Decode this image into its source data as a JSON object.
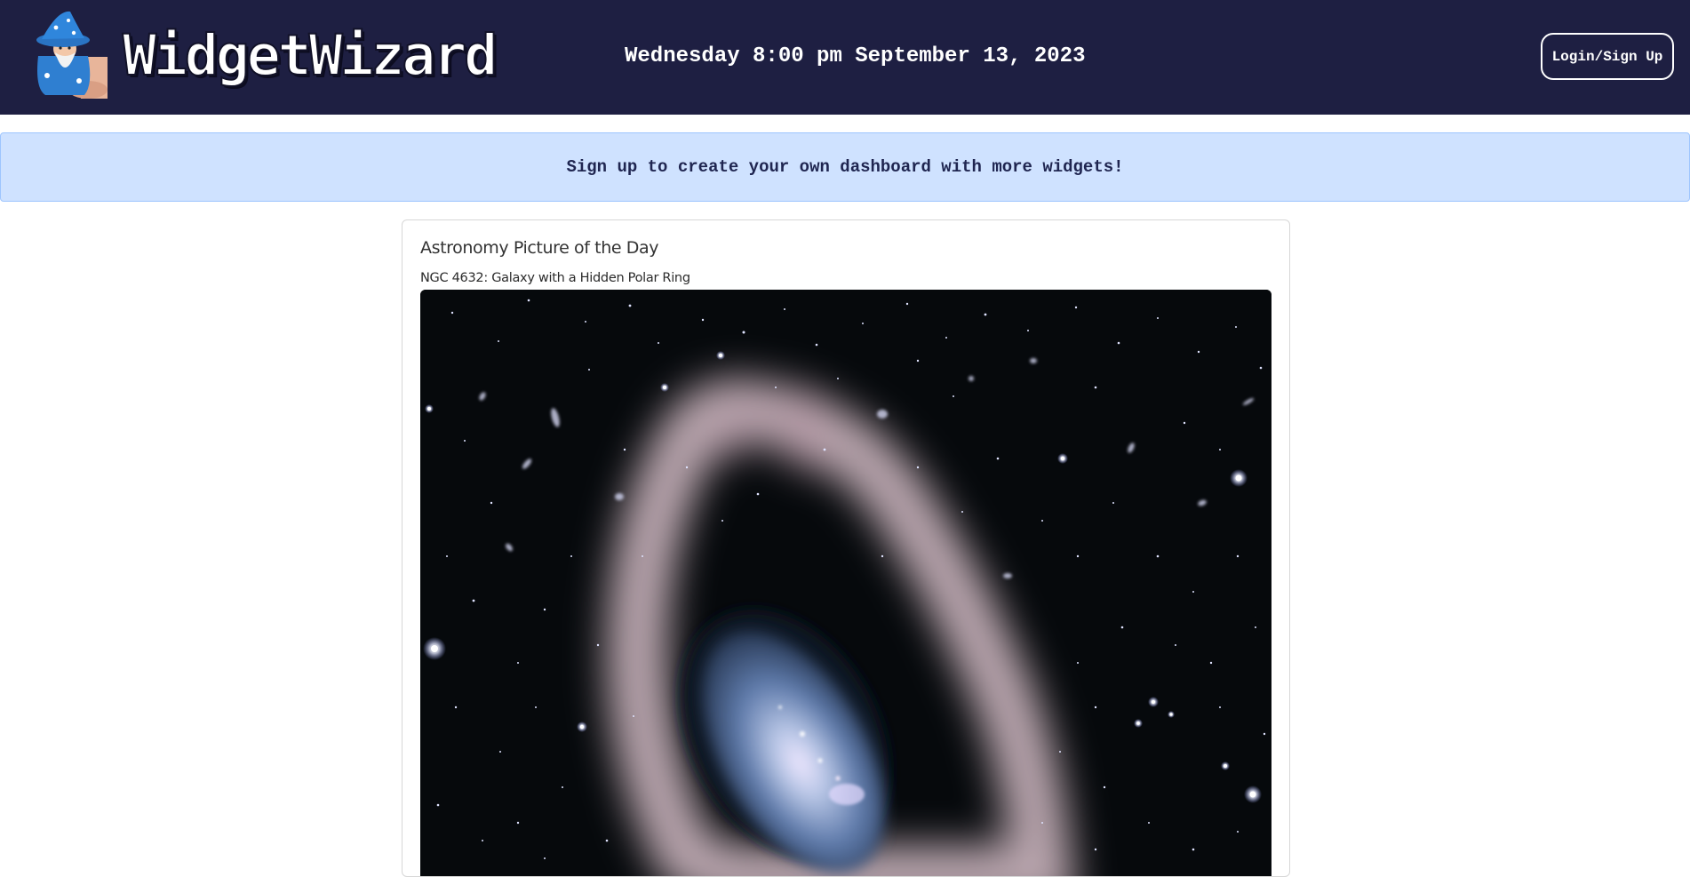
{
  "header": {
    "brand": "WidgetWizard",
    "datetime": "Wednesday 8:00 pm September 13, 2023",
    "login_label": "Login/Sign Up",
    "background_color": "#1e1f42"
  },
  "banner": {
    "text": "Sign up to create your own dashboard with more widgets!",
    "background_color": "#cfe2ff"
  },
  "widget": {
    "heading": "Astronomy Picture of the Day",
    "apod_title": "NGC 4632: Galaxy with a Hidden Polar Ring"
  },
  "icons": {
    "logo": "wizard-mascot-icon"
  }
}
